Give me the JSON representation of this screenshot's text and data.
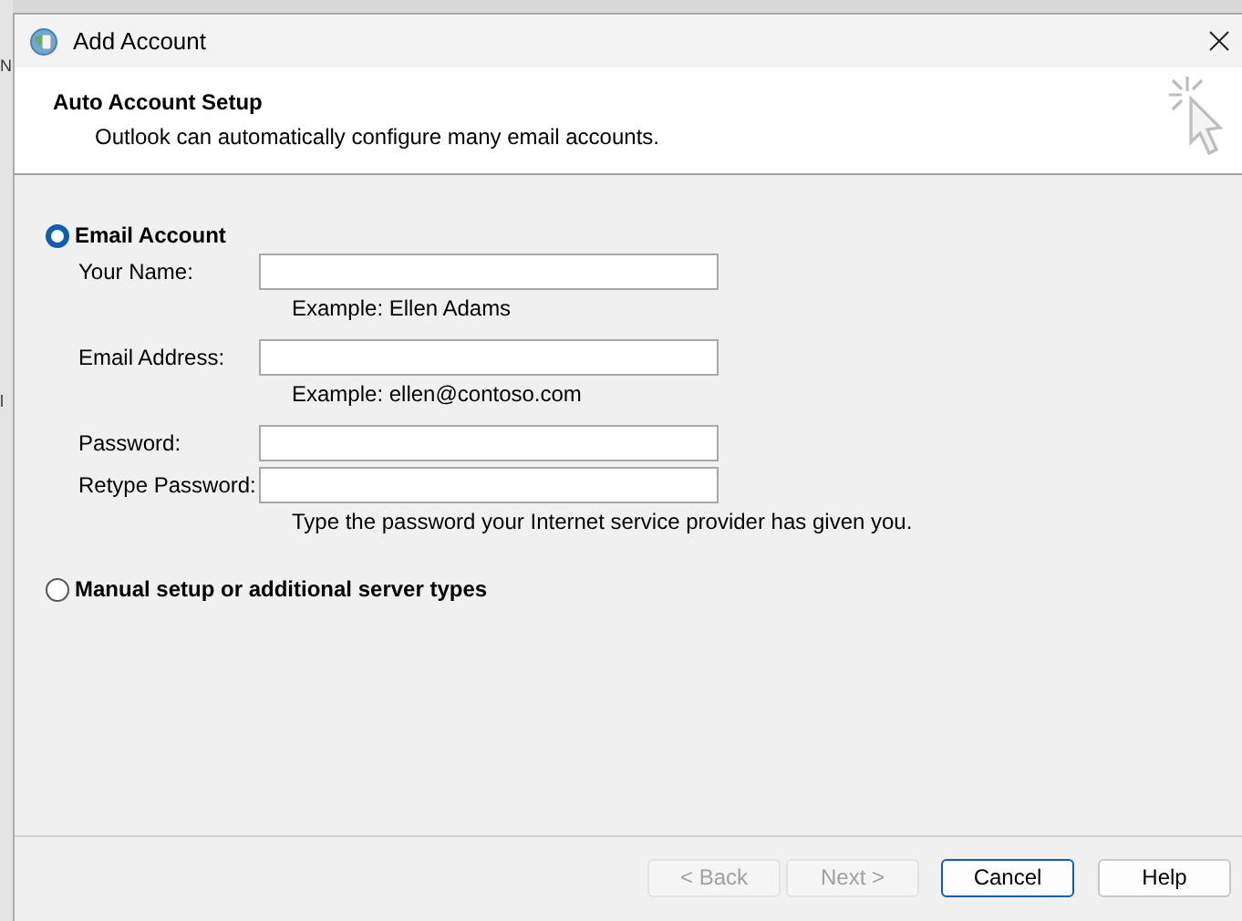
{
  "background_fragments": [
    "N",
    "l"
  ],
  "window": {
    "title": "Add Account"
  },
  "header": {
    "title": "Auto Account Setup",
    "subtitle": "Outlook can automatically configure many email accounts."
  },
  "options": [
    {
      "label": "Email Account",
      "selected": true,
      "fields": [
        {
          "label": "Your Name:",
          "hint": "Example: Ellen Adams"
        },
        {
          "label": "Email Address:",
          "hint": "Example: ellen@contoso.com"
        },
        {
          "label": "Password:"
        },
        {
          "label": "Retype Password:",
          "hint": "Type the password your Internet service provider has given you."
        }
      ]
    },
    {
      "label": "Manual setup or additional server types",
      "selected": false
    }
  ],
  "buttons": [
    {
      "label": "< Back",
      "disabled": true,
      "default": false
    },
    {
      "label": "Next >",
      "disabled": true,
      "default": false
    },
    {
      "label": "Cancel",
      "disabled": false,
      "default": true
    },
    {
      "label": "Help",
      "disabled": false,
      "default": false
    }
  ]
}
